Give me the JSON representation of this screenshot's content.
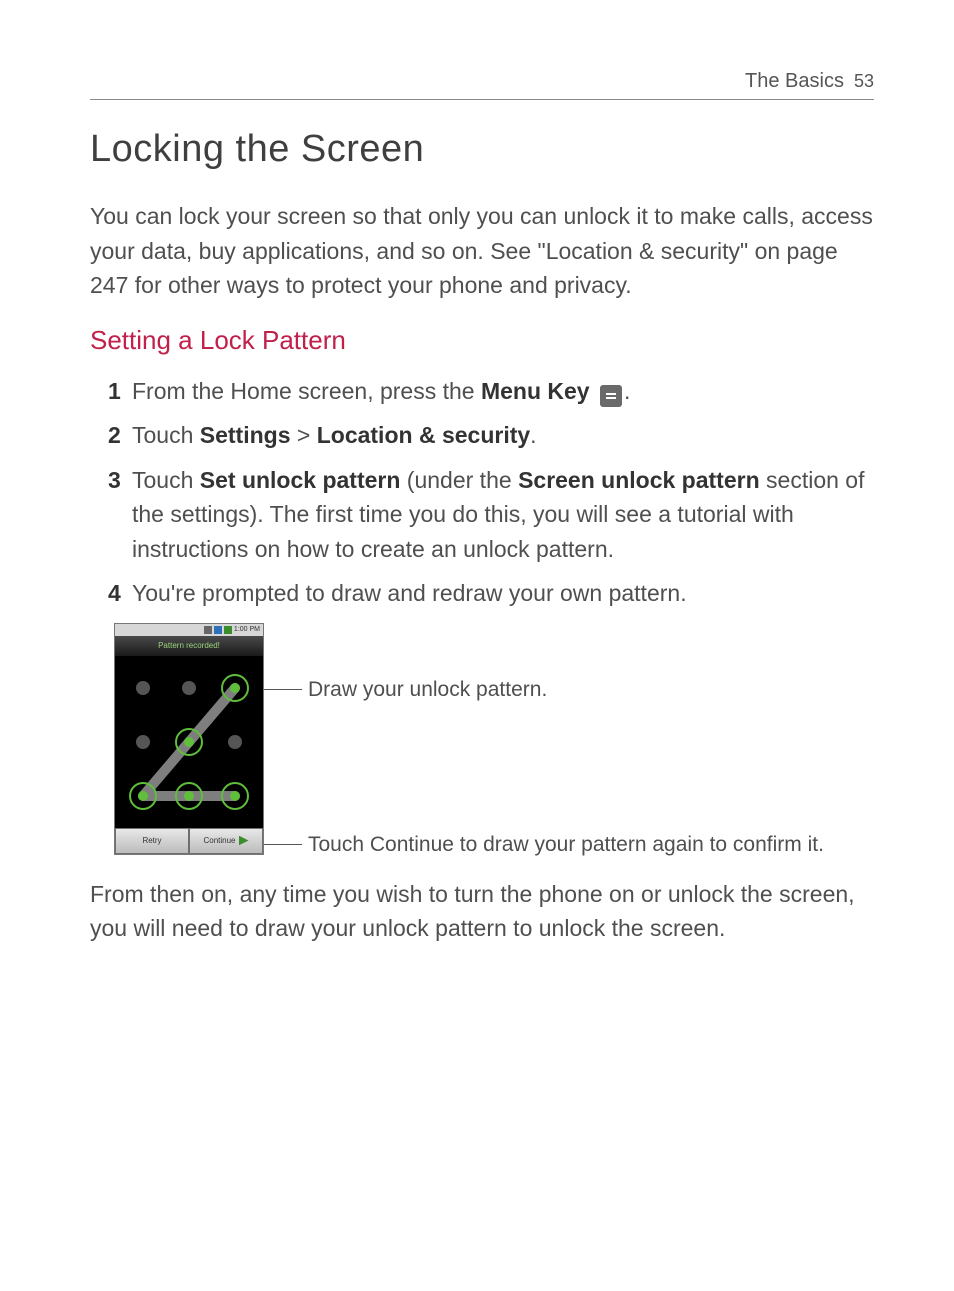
{
  "header": {
    "section": "The Basics",
    "page_number": "53"
  },
  "title": "Locking the Screen",
  "intro": "You can lock your screen so that only you can unlock it to make calls, access your data, buy applications, and so on. See \"Location & security\" on page 247 for other ways to protect your phone and privacy.",
  "subheading": "Setting a Lock Pattern",
  "steps": {
    "s1": {
      "num": "1",
      "pre": " From the Home screen, press the ",
      "bold": "Menu Key",
      "post": "."
    },
    "s2": {
      "num": "2",
      "pre": " Touch ",
      "b1": "Settings",
      "gt": " > ",
      "b2": "Location & security",
      "post": "."
    },
    "s3": {
      "num": "3",
      "pre": " Touch ",
      "b1": "Set unlock pattern",
      "mid": " (under the ",
      "b2": "Screen unlock pattern",
      "post": " section of the settings). The first time you do this, you will see a tutorial with instructions on how to create an unlock pattern."
    },
    "s4": {
      "num": "4",
      "text": " You're prompted to draw and redraw your own pattern."
    }
  },
  "phone": {
    "status_time": "1:00 PM",
    "screen_title": "Pattern recorded!",
    "btn_left": "Retry",
    "btn_right": "Continue"
  },
  "callouts": {
    "c1": "Draw your unlock pattern.",
    "c2": "Touch Continue to draw your pattern again to confirm it."
  },
  "outro": "From then on, any time you wish to turn the phone on or unlock the screen, you will need to draw your unlock pattern to unlock the screen."
}
